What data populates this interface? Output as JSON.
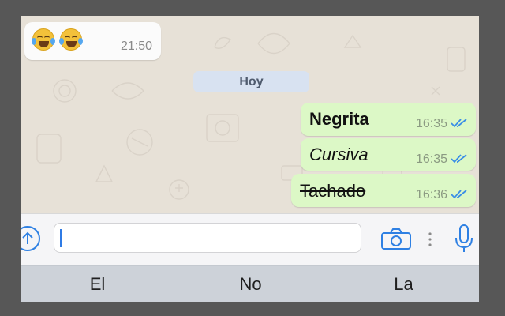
{
  "incoming": {
    "time": "21:50",
    "emoji": [
      "face-with-tears-of-joy",
      "face-with-tears-of-joy"
    ]
  },
  "date_chip": "Hoy",
  "messages": [
    {
      "text": "Negrita",
      "style": "bold",
      "time": "16:35",
      "status": "read"
    },
    {
      "text": "Cursiva",
      "style": "italic",
      "time": "16:35",
      "status": "read"
    },
    {
      "text": "Tachado",
      "style": "strikethrough",
      "time": "16:36",
      "status": "read"
    }
  ],
  "composer": {
    "input_value": "",
    "placeholder": ""
  },
  "suggestions": [
    "El",
    "No",
    "La"
  ],
  "colors": {
    "outgoing_bubble": "#dcf8c6",
    "incoming_bubble": "#fbfbfb",
    "chat_background": "#e7e1d7",
    "read_ticks": "#3a8ee6",
    "accent": "#2e80e3"
  },
  "icons": [
    "upload-icon",
    "camera-icon",
    "more-icon",
    "microphone-icon",
    "read-receipt-icon"
  ]
}
